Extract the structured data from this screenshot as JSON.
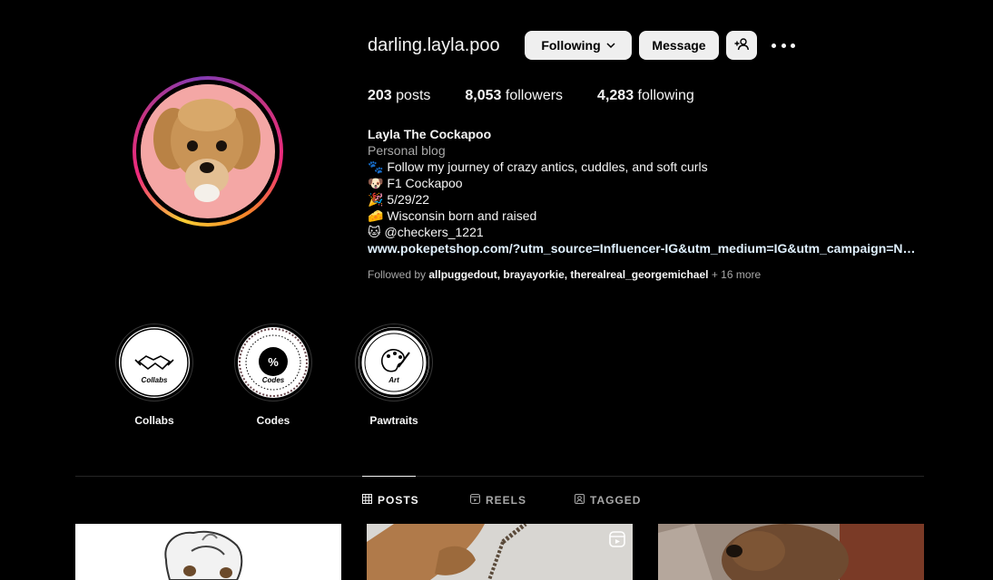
{
  "profile": {
    "username": "darling.layla.poo",
    "following_label": "Following",
    "message_label": "Message",
    "stats": {
      "posts_count": "203",
      "posts_label": "posts",
      "followers_count": "8,053",
      "followers_label": "followers",
      "following_count": "4,283",
      "following_label": "following"
    },
    "bio": {
      "name": "Layla The Cockapoo",
      "category": "Personal blog",
      "lines": [
        "🐾 Follow my journey of crazy antics, cuddles, and soft curls",
        "🐶 F1 Cockapoo",
        "🎉 5/29/22",
        "🧀 Wisconsin born and raised",
        "🐱 @checkers_1221"
      ],
      "link": "www.pokepetshop.com/?utm_source=Influencer-IG&utm_medium=IG&utm_campaign=Normal-Referral"
    },
    "followed_by": {
      "prefix": "Followed by",
      "names": "allpuggedout, brayayorkie, therealreal_georgemichael",
      "more": "+ 16 more"
    }
  },
  "highlights": [
    {
      "label": "Collabs",
      "cover_text": "Collabs"
    },
    {
      "label": "Codes",
      "cover_text": "Codes"
    },
    {
      "label": "Pawtraits",
      "cover_text": "Art"
    }
  ],
  "tabs": [
    {
      "label": "POSTS",
      "icon": "grid-icon",
      "active": true
    },
    {
      "label": "REELS",
      "icon": "reels-icon",
      "active": false
    },
    {
      "label": "TAGGED",
      "icon": "tagged-icon",
      "active": false
    }
  ],
  "colors": {
    "background": "#000000",
    "text": "#f5f5f5",
    "muted": "#a8a8a8",
    "button_bg": "#efefef",
    "link": "#e0f1ff"
  }
}
